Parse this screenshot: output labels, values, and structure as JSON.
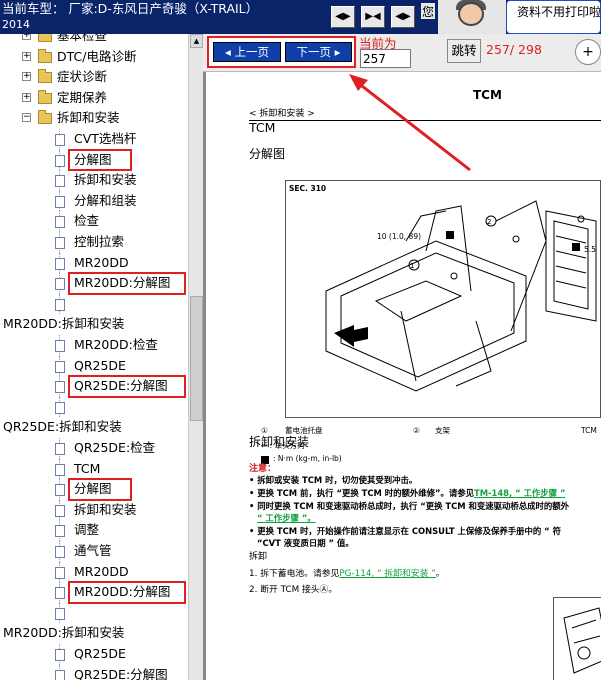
{
  "topbar": {
    "model_label": "当前车型：  厂家:D-东风日产奇骏（X-TRAIL）",
    "year": "2014",
    "nav_prev_glyph": "◀▶",
    "nav_mid_glyph": "▶◀",
    "nav_next_glyph": "◀▶",
    "side_text": "您",
    "bubble_text": "资料不用打印啦"
  },
  "tree": {
    "items": [
      {
        "label": "基本检查"
      },
      {
        "label": "DTC/电路诊断"
      },
      {
        "label": "症状诊断"
      },
      {
        "label": "定期保养"
      },
      {
        "label": "拆卸和安装"
      },
      {
        "label": "CVT选档杆"
      },
      {
        "label": "分解图"
      },
      {
        "label": "拆卸和安装"
      },
      {
        "label": "分解和组装"
      },
      {
        "label": "检查"
      },
      {
        "label": "控制拉索"
      },
      {
        "label": "MR20DD"
      },
      {
        "label": "MR20DD:分解图"
      },
      {
        "label": ""
      },
      {
        "label": "MR20DD:拆卸和安装"
      },
      {
        "label": "MR20DD:检查"
      },
      {
        "label": "QR25DE"
      },
      {
        "label": "QR25DE:分解图"
      },
      {
        "label": ""
      },
      {
        "label": "QR25DE:拆卸和安装"
      },
      {
        "label": "QR25DE:检查"
      },
      {
        "label": "TCM"
      },
      {
        "label": "分解图"
      },
      {
        "label": "拆卸和安装"
      },
      {
        "label": "调整"
      },
      {
        "label": "通气管"
      },
      {
        "label": "MR20DD"
      },
      {
        "label": "MR20DD:分解图"
      },
      {
        "label": ""
      },
      {
        "label": "MR20DD:拆卸和安装"
      },
      {
        "label": "QR25DE"
      },
      {
        "label": "QR25DE:分解图"
      }
    ]
  },
  "toolbar": {
    "prev_label": "上一页",
    "next_label": "下一页",
    "current_label": "当前为",
    "page_value": "257",
    "jump_label": "跳转",
    "page_count": "257/ 298",
    "zoom_glyph": "+"
  },
  "doc": {
    "header": "TCM",
    "breadcrumb": "< 拆卸和安装 >",
    "subtitle": "TCM",
    "section1": "分解图",
    "figure": {
      "section_no": "SEC. 310",
      "torque_label": "10 (1.0, 89)",
      "torque_label2": "5.5",
      "legend1_num": "①",
      "legend1": "蓄电池托盘",
      "legend2_num": "②",
      "legend2": "支架",
      "legend3": "TCM",
      "arrow_note": "⇦ : 车头方向",
      "torque_note": ": N·m (kg-m, in-lb)"
    },
    "section2": "拆卸和安装",
    "note_title": "注意：",
    "notes": [
      "• 拆卸或安装 TCM 时，切勿使其受到冲击。",
      "• 更换 TCM 前，执行 “更换 TCM 时的额外维修”。请参见",
      "TM-148, “ 工作步骤 ”",
      "• 同时更换 TCM 和变速驱动桥总成时，执行 “更换 TCM 和变速驱动桥总成时的额外",
      "“ 工作步骤 ”。",
      "• 更换 TCM 时，开始操作前请注意显示在 CONSULT 上保修及保养手册中的 “ 符",
      "“CVT 液变质日期 ” 值。"
    ],
    "removal_head": "拆卸",
    "step1": "1.   拆下蓄电池。请参见",
    "step1_link": "PG-114, “ 拆卸和安装 ”",
    "step1_end": "。",
    "step2": "2.   断开 TCM 接头Ⓐ。"
  }
}
